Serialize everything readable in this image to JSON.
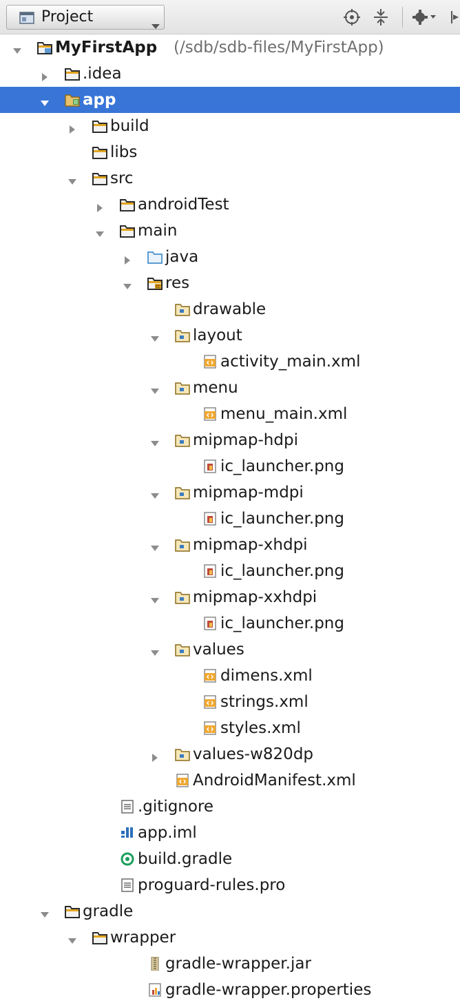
{
  "toolbar": {
    "view_selector_label": "Project",
    "colors": {
      "selection": "#3875d7",
      "folder": "#e1a520",
      "source_folder": "#5c9bd1"
    }
  },
  "tree": [
    {
      "label": "MyFirstApp",
      "path": "(/sdb/sdb-files/MyFirstApp)",
      "depth": 0,
      "state": "expanded",
      "icon": "project-module-icon"
    },
    {
      "label": ".idea",
      "depth": 1,
      "state": "collapsed",
      "icon": "folder-icon"
    },
    {
      "label": "app",
      "depth": 1,
      "state": "expanded",
      "icon": "module-folder-icon",
      "selected": true
    },
    {
      "label": "build",
      "depth": 2,
      "state": "collapsed",
      "icon": "folder-icon"
    },
    {
      "label": "libs",
      "depth": 2,
      "state": "leaf",
      "icon": "folder-icon"
    },
    {
      "label": "src",
      "depth": 2,
      "state": "expanded",
      "icon": "folder-icon"
    },
    {
      "label": "androidTest",
      "depth": 3,
      "state": "collapsed",
      "icon": "folder-icon"
    },
    {
      "label": "main",
      "depth": 3,
      "state": "expanded",
      "icon": "folder-icon"
    },
    {
      "label": "java",
      "depth": 4,
      "state": "collapsed",
      "icon": "source-folder-icon"
    },
    {
      "label": "res",
      "depth": 4,
      "state": "expanded",
      "icon": "resource-root-icon"
    },
    {
      "label": "drawable",
      "depth": 5,
      "state": "leaf",
      "icon": "resource-folder-icon"
    },
    {
      "label": "layout",
      "depth": 5,
      "state": "expanded",
      "icon": "resource-folder-icon"
    },
    {
      "label": "activity_main.xml",
      "depth": 6,
      "state": "leaf",
      "icon": "xml-file-icon"
    },
    {
      "label": "menu",
      "depth": 5,
      "state": "expanded",
      "icon": "resource-folder-icon"
    },
    {
      "label": "menu_main.xml",
      "depth": 6,
      "state": "leaf",
      "icon": "xml-file-icon"
    },
    {
      "label": "mipmap-hdpi",
      "depth": 5,
      "state": "expanded",
      "icon": "resource-folder-icon"
    },
    {
      "label": "ic_launcher.png",
      "depth": 6,
      "state": "leaf",
      "icon": "image-file-icon"
    },
    {
      "label": "mipmap-mdpi",
      "depth": 5,
      "state": "expanded",
      "icon": "resource-folder-icon"
    },
    {
      "label": "ic_launcher.png",
      "depth": 6,
      "state": "leaf",
      "icon": "image-file-icon"
    },
    {
      "label": "mipmap-xhdpi",
      "depth": 5,
      "state": "expanded",
      "icon": "resource-folder-icon"
    },
    {
      "label": "ic_launcher.png",
      "depth": 6,
      "state": "leaf",
      "icon": "image-file-icon"
    },
    {
      "label": "mipmap-xxhdpi",
      "depth": 5,
      "state": "expanded",
      "icon": "resource-folder-icon"
    },
    {
      "label": "ic_launcher.png",
      "depth": 6,
      "state": "leaf",
      "icon": "image-file-icon"
    },
    {
      "label": "values",
      "depth": 5,
      "state": "expanded",
      "icon": "resource-folder-icon"
    },
    {
      "label": "dimens.xml",
      "depth": 6,
      "state": "leaf",
      "icon": "xml-file-icon"
    },
    {
      "label": "strings.xml",
      "depth": 6,
      "state": "leaf",
      "icon": "xml-file-icon"
    },
    {
      "label": "styles.xml",
      "depth": 6,
      "state": "leaf",
      "icon": "xml-file-icon"
    },
    {
      "label": "values-w820dp",
      "depth": 5,
      "state": "collapsed",
      "icon": "resource-folder-icon"
    },
    {
      "label": "AndroidManifest.xml",
      "depth": 5,
      "state": "leaf",
      "icon": "xml-file-icon"
    },
    {
      "label": ".gitignore",
      "depth": 3,
      "state": "leaf",
      "icon": "text-file-icon"
    },
    {
      "label": "app.iml",
      "depth": 3,
      "state": "leaf",
      "icon": "iml-file-icon"
    },
    {
      "label": "build.gradle",
      "depth": 3,
      "state": "leaf",
      "icon": "gradle-file-icon"
    },
    {
      "label": "proguard-rules.pro",
      "depth": 3,
      "state": "leaf",
      "icon": "text-file-icon"
    },
    {
      "label": "gradle",
      "depth": 1,
      "state": "expanded",
      "icon": "folder-icon"
    },
    {
      "label": "wrapper",
      "depth": 2,
      "state": "expanded",
      "icon": "folder-icon"
    },
    {
      "label": "gradle-wrapper.jar",
      "depth": 4,
      "state": "leaf",
      "icon": "jar-file-icon"
    },
    {
      "label": "gradle-wrapper.properties",
      "depth": 4,
      "state": "leaf",
      "icon": "properties-file-icon"
    }
  ]
}
